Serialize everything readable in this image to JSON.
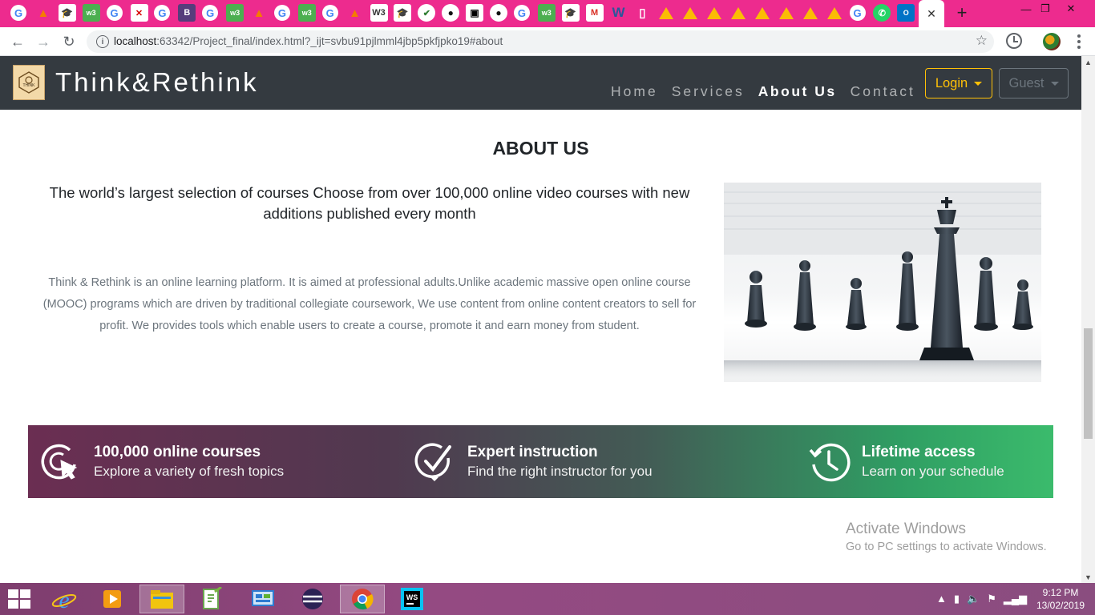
{
  "browser": {
    "url_host": "localhost",
    "url_rest": ":63342/Project_final/index.html?_ijt=svbu91pjlmml4jbp5pkfjpko19#about",
    "tabs": [
      {
        "icon": "google-icon",
        "kind": "g",
        "glyph": "G"
      },
      {
        "icon": "flame-icon",
        "kind": "flame",
        "glyph": "▲"
      },
      {
        "icon": "graduation-cap-icon",
        "kind": "hat",
        "glyph": "🎓"
      },
      {
        "icon": "w3schools-icon",
        "kind": "w3",
        "glyph": "w3"
      },
      {
        "icon": "google-icon",
        "kind": "g",
        "glyph": "G"
      },
      {
        "icon": "close-box-icon",
        "kind": "red",
        "glyph": "✕"
      },
      {
        "icon": "google-icon",
        "kind": "g",
        "glyph": "G"
      },
      {
        "icon": "bootstrap-icon",
        "kind": "b",
        "glyph": "B"
      },
      {
        "icon": "google-icon",
        "kind": "g",
        "glyph": "G"
      },
      {
        "icon": "w3schools-icon",
        "kind": "w3",
        "glyph": "w3"
      },
      {
        "icon": "flame-icon",
        "kind": "flame",
        "glyph": "▲"
      },
      {
        "icon": "google-icon",
        "kind": "g",
        "glyph": "G"
      },
      {
        "icon": "w3schools-icon",
        "kind": "w3",
        "glyph": "w3"
      },
      {
        "icon": "google-icon",
        "kind": "g",
        "glyph": "G"
      },
      {
        "icon": "flame-icon",
        "kind": "flame",
        "glyph": "▲"
      },
      {
        "icon": "w3c-icon",
        "kind": "sq",
        "glyph": "W3"
      },
      {
        "icon": "graduation-cap-icon",
        "kind": "hat",
        "glyph": "🎓"
      },
      {
        "icon": "shield-check-icon",
        "kind": "lock",
        "glyph": "✔"
      },
      {
        "icon": "github-icon",
        "kind": "gh",
        "glyph": "●"
      },
      {
        "icon": "briefcase-icon",
        "kind": "hat",
        "glyph": "▣"
      },
      {
        "icon": "github-icon",
        "kind": "gh",
        "glyph": "●"
      },
      {
        "icon": "google-icon",
        "kind": "g",
        "glyph": "G"
      },
      {
        "icon": "w3schools-icon",
        "kind": "w3",
        "glyph": "w3"
      },
      {
        "icon": "graduation-cap-icon",
        "kind": "hat",
        "glyph": "🎓"
      },
      {
        "icon": "gmail-icon",
        "kind": "gm",
        "glyph": "M"
      },
      {
        "icon": "word-icon",
        "kind": "word",
        "glyph": "W"
      },
      {
        "icon": "document-icon",
        "kind": "doc",
        "glyph": "▯"
      },
      {
        "icon": "google-drive-icon",
        "kind": "drive",
        "glyph": ""
      },
      {
        "icon": "google-drive-icon",
        "kind": "drive",
        "glyph": ""
      },
      {
        "icon": "google-drive-icon",
        "kind": "drive",
        "glyph": ""
      },
      {
        "icon": "google-drive-icon",
        "kind": "drive",
        "glyph": ""
      },
      {
        "icon": "google-slides-icon",
        "kind": "drive",
        "glyph": ""
      },
      {
        "icon": "google-drive-icon",
        "kind": "drive",
        "glyph": ""
      },
      {
        "icon": "google-drive-icon",
        "kind": "drive",
        "glyph": ""
      },
      {
        "icon": "google-drive-icon",
        "kind": "drive",
        "glyph": ""
      },
      {
        "icon": "google-icon",
        "kind": "g",
        "glyph": "G"
      },
      {
        "icon": "whatsapp-icon",
        "kind": "wa",
        "glyph": "✆"
      },
      {
        "icon": "outlook-icon",
        "kind": "ol",
        "glyph": "O"
      }
    ],
    "active_tab_close": "✕",
    "new_tab": "+"
  },
  "site": {
    "brand": "Think&Rethink",
    "logo_text": "THINK",
    "nav": [
      "Home",
      "Services",
      "About Us",
      "Contact"
    ],
    "active_nav": "About Us",
    "login_label": "Login",
    "guest_label": "Guest"
  },
  "about": {
    "title": "ABOUT US",
    "lead": "The world’s largest selection of courses Choose from over 100,000 online video courses with new additions published every month",
    "description": "Think & Rethink is an online learning platform. It is aimed at professional adults.Unlike academic massive open online course (MOOC) programs which are driven by traditional collegiate coursework, We use content from online content creators to sell for profit. We provides tools which enable users to create a course, promote it and earn money from student."
  },
  "features": [
    {
      "title": "100,000 online courses",
      "subtitle": "Explore a variety of fresh topics",
      "icon": "cursor-target-icon"
    },
    {
      "title": "Expert instruction",
      "subtitle": "Find the right instructor for you",
      "icon": "checkmark-badge-icon"
    },
    {
      "title": "Lifetime access",
      "subtitle": "Learn on your schedule",
      "icon": "clock-history-icon"
    }
  ],
  "watermark": {
    "title": "Activate Windows",
    "subtitle": "Go to PC settings to activate Windows."
  },
  "taskbar": {
    "apps": [
      "internet-explorer-icon",
      "media-player-icon",
      "file-explorer-icon",
      "notepad-plus-plus-icon",
      "control-panel-icon",
      "eclipse-icon",
      "chrome-icon",
      "webstorm-icon"
    ],
    "time": "9:12 PM",
    "date": "13/02/2019"
  },
  "colors": {
    "navbar": "#343a40",
    "login_accent": "#ffc107",
    "banner_start": "#6b2e52",
    "banner_end": "#3bbb6c"
  }
}
